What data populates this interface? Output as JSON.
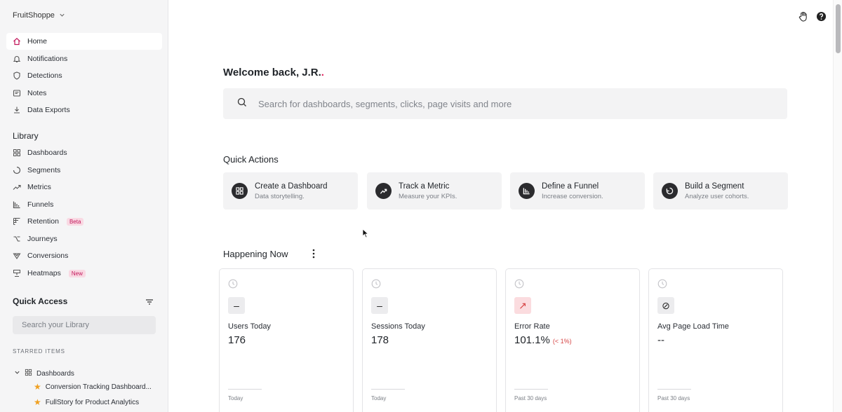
{
  "org": {
    "name": "FruitShoppe"
  },
  "nav": [
    {
      "label": "Home",
      "icon": "home-icon"
    },
    {
      "label": "Notifications",
      "icon": "bell-icon"
    },
    {
      "label": "Detections",
      "icon": "shield-icon"
    },
    {
      "label": "Notes",
      "icon": "note-icon"
    },
    {
      "label": "Data Exports",
      "icon": "download-icon"
    }
  ],
  "library": {
    "title": "Library",
    "items": [
      {
        "label": "Dashboards",
        "icon": "grid-icon",
        "badge": ""
      },
      {
        "label": "Segments",
        "icon": "segment-icon",
        "badge": ""
      },
      {
        "label": "Metrics",
        "icon": "trend-icon",
        "badge": ""
      },
      {
        "label": "Funnels",
        "icon": "funnel-bars-icon",
        "badge": ""
      },
      {
        "label": "Retention",
        "icon": "retention-icon",
        "badge": "Beta"
      },
      {
        "label": "Journeys",
        "icon": "journey-icon",
        "badge": ""
      },
      {
        "label": "Conversions",
        "icon": "conversion-icon",
        "badge": ""
      },
      {
        "label": "Heatmaps",
        "icon": "heatmap-icon",
        "badge": "New"
      }
    ]
  },
  "quick_access": {
    "title": "Quick Access",
    "search_placeholder": "Search your Library",
    "starred_label": "STARRED ITEMS",
    "folder": "Dashboards",
    "starred": [
      "Conversion Tracking Dashboard...",
      "FullStory for Product Analytics"
    ]
  },
  "main": {
    "welcome_text": "Welcome back, J.R.",
    "welcome_dot": ".",
    "search_placeholder": "Search for dashboards, segments, clicks, page visits and more",
    "quick_actions_title": "Quick Actions",
    "quick_actions": [
      {
        "title": "Create a Dashboard",
        "subtitle": "Data storytelling."
      },
      {
        "title": "Track a Metric",
        "subtitle": "Measure your KPIs."
      },
      {
        "title": "Define a Funnel",
        "subtitle": "Increase conversion."
      },
      {
        "title": "Build a Segment",
        "subtitle": "Analyze user cohorts."
      }
    ],
    "happening_title": "Happening Now",
    "metrics": [
      {
        "name": "Users Today",
        "value": "176",
        "delta": "",
        "period": "Today",
        "tile": "–"
      },
      {
        "name": "Sessions Today",
        "value": "178",
        "delta": "",
        "period": "Today",
        "tile": "–"
      },
      {
        "name": "Error Rate",
        "value": "101.1%",
        "delta": "(< 1%)",
        "period": "Past 30 days",
        "tile": "↗"
      },
      {
        "name": "Avg Page Load Time",
        "value": "--",
        "delta": "",
        "period": "Past 30 days",
        "tile": "⊘"
      }
    ]
  },
  "colors": {
    "accent": "#c2185b",
    "danger": "#d64545",
    "sidebar_bg": "#f5f5f6"
  }
}
